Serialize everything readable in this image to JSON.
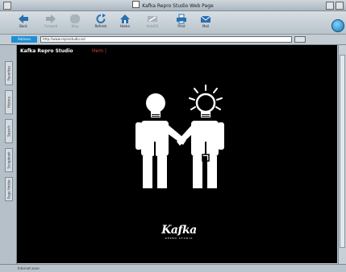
{
  "window": {
    "title": "Kafka Repro Studio Web Page"
  },
  "toolbar": {
    "buttons": [
      {
        "label": "Back",
        "icon": "back-arrow-icon",
        "enabled": true
      },
      {
        "label": "Forward",
        "icon": "forward-arrow-icon",
        "enabled": false
      },
      {
        "label": "Stop",
        "icon": "stop-icon",
        "enabled": false
      },
      {
        "label": "Refresh",
        "icon": "refresh-icon",
        "enabled": true
      },
      {
        "label": "Home",
        "icon": "home-icon",
        "enabled": true
      },
      {
        "label": "AutoFill",
        "icon": "autofill-icon",
        "enabled": false
      },
      {
        "label": "Print",
        "icon": "print-icon",
        "enabled": true
      },
      {
        "label": "Mail",
        "icon": "mail-icon",
        "enabled": true
      }
    ]
  },
  "address": {
    "label": "Address",
    "url": "http://www.reprostudio.se/"
  },
  "sidebar": {
    "tabs": [
      "Favorites",
      "History",
      "Search",
      "Scrapbook",
      "Page Holder"
    ]
  },
  "page": {
    "site_title": "Kafka Repro Studio",
    "nav_text": "Hem  |  "
  },
  "logo": {
    "word": "Kafka",
    "tagline": "REPRO STUDIO"
  },
  "status": {
    "text": "Internet zone"
  },
  "colors": {
    "accent": "#1d8fd6",
    "nav": "#d0453a",
    "content_bg": "#000000"
  }
}
